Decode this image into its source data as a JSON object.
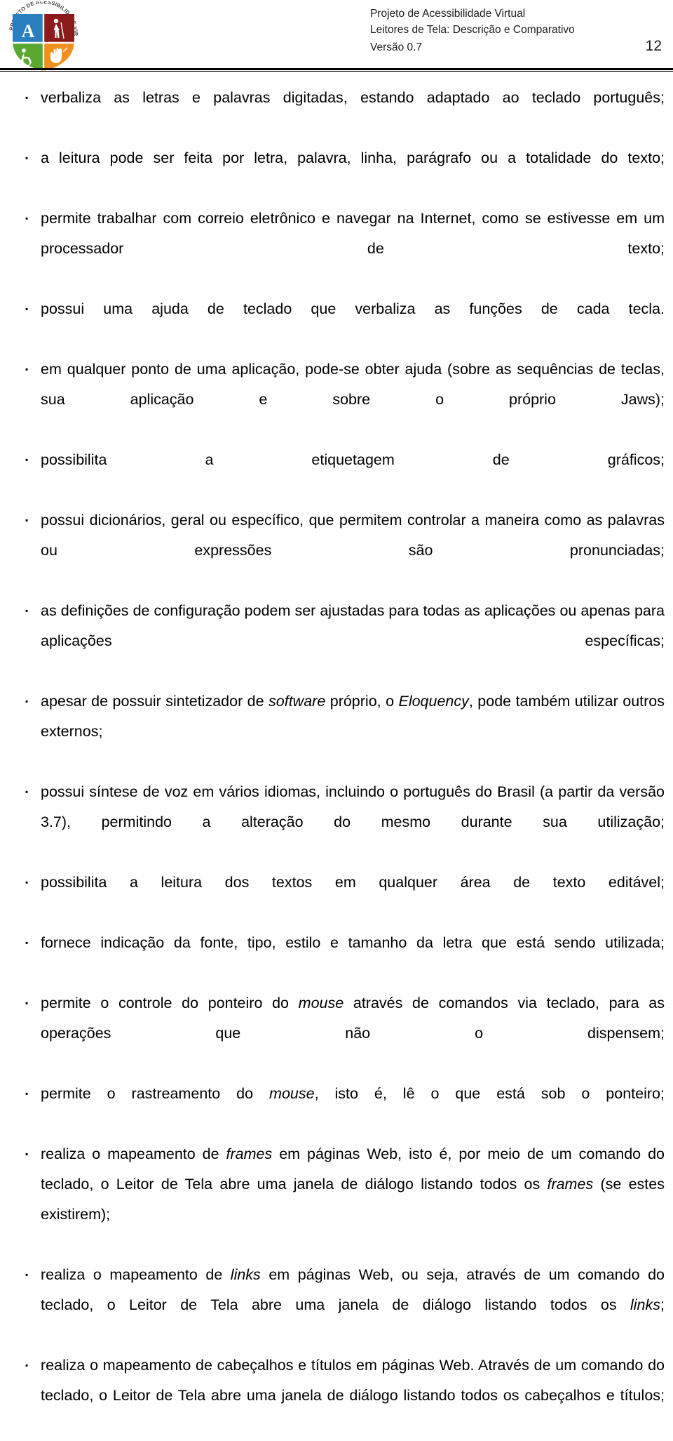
{
  "header": {
    "logo": {
      "name": "accessibility-virtual-project-logo",
      "ring_text": "PROJETO DE ACESSIBILIDADE VIRTUAL",
      "quadrants": [
        {
          "name": "letter-a-quadrant",
          "glyph": "A",
          "color": "#2a7fc1"
        },
        {
          "name": "blind-person-cane-quadrant",
          "glyph": "blind-cane-icon",
          "color": "#8c1a1a"
        },
        {
          "name": "wheelchair-quadrant",
          "glyph": "wheelchair-icon",
          "color": "#5aa832"
        },
        {
          "name": "sign-language-hand-quadrant",
          "glyph": "hand-sign-icon",
          "color": "#f0901e"
        }
      ]
    },
    "line1": "Projeto de Acessibilidade Virtual",
    "line2": "Leitores de Tela: Descrição e Comparativo",
    "version": "Versão 0.7",
    "page_number": "12"
  },
  "bullet_glyph": "▪",
  "items": [
    {
      "id": "item-1",
      "parts": [
        {
          "t": "verbaliza as letras e palavras digitadas, estando adaptado ao teclado português;"
        }
      ]
    },
    {
      "id": "item-2",
      "parts": [
        {
          "t": "a leitura pode ser feita por letra, palavra, linha, parágrafo ou a totalidade do texto;"
        }
      ]
    },
    {
      "id": "item-3",
      "parts": [
        {
          "t": "permite trabalhar com correio eletrônico e navegar na Internet, como se estivesse em um processador de texto;"
        }
      ]
    },
    {
      "id": "item-4",
      "parts": [
        {
          "t": "possui uma ajuda de teclado que verbaliza as funções de cada tecla."
        }
      ]
    },
    {
      "id": "item-5",
      "parts": [
        {
          "t": "em qualquer ponto de uma aplicação, pode-se obter ajuda (sobre as sequências de teclas, sua aplicação e sobre o próprio Jaws);"
        }
      ]
    },
    {
      "id": "item-6",
      "parts": [
        {
          "t": "possibilita a etiquetagem de gráficos;"
        }
      ]
    },
    {
      "id": "item-7",
      "parts": [
        {
          "t": "possui dicionários, geral ou específico, que permitem controlar a maneira como as palavras ou expressões são pronunciadas;"
        }
      ]
    },
    {
      "id": "item-8",
      "parts": [
        {
          "t": "as definições de configuração podem ser ajustadas para todas as aplicações ou apenas para aplicações específicas;"
        }
      ]
    },
    {
      "id": "item-9",
      "parts": [
        {
          "t": "apesar de possuir sintetizador de "
        },
        {
          "t": "software",
          "i": true
        },
        {
          "t": " próprio, o "
        },
        {
          "t": "Eloquency",
          "i": true
        },
        {
          "t": ", pode também utilizar outros externos;"
        }
      ]
    },
    {
      "id": "item-10",
      "parts": [
        {
          "t": "possui síntese de voz em vários idiomas, incluindo o português do Brasil (a partir da versão 3.7), permitindo a alteração do mesmo durante sua utilização;"
        }
      ]
    },
    {
      "id": "item-11",
      "parts": [
        {
          "t": "possibilita a leitura dos textos em qualquer área de texto editável;"
        }
      ]
    },
    {
      "id": "item-12",
      "parts": [
        {
          "t": "fornece indicação da fonte, tipo, estilo e tamanho da letra que está sendo utilizada;"
        }
      ]
    },
    {
      "id": "item-13",
      "parts": [
        {
          "t": "permite o controle do ponteiro do "
        },
        {
          "t": "mouse",
          "i": true
        },
        {
          "t": " através de comandos via teclado, para as operações que não o dispensem;"
        }
      ]
    },
    {
      "id": "item-14",
      "parts": [
        {
          "t": "permite o rastreamento do "
        },
        {
          "t": "mouse",
          "i": true
        },
        {
          "t": ", isto é, lê o que está sob o ponteiro;"
        }
      ]
    },
    {
      "id": "item-15",
      "parts": [
        {
          "t": "realiza o mapeamento de "
        },
        {
          "t": "frames",
          "i": true
        },
        {
          "t": " em páginas Web, isto é, por meio de um comando do teclado, o Leitor de Tela abre uma janela de diálogo listando todos os "
        },
        {
          "t": "frames",
          "i": true
        },
        {
          "t": " (se estes existirem);"
        }
      ]
    },
    {
      "id": "item-16",
      "parts": [
        {
          "t": "realiza o mapeamento de "
        },
        {
          "t": "links",
          "i": true
        },
        {
          "t": " em páginas Web, ou seja, através de um comando do teclado, o Leitor de Tela abre uma janela de diálogo listando todos os "
        },
        {
          "t": "links",
          "i": true
        },
        {
          "t": ";"
        }
      ]
    },
    {
      "id": "item-17",
      "parts": [
        {
          "t": "realiza o mapeamento de cabeçalhos e títulos em páginas Web. Através de um comando do teclado, o Leitor de Tela abre uma janela de diálogo listando todos os cabeçalhos e títulos;"
        }
      ]
    }
  ]
}
